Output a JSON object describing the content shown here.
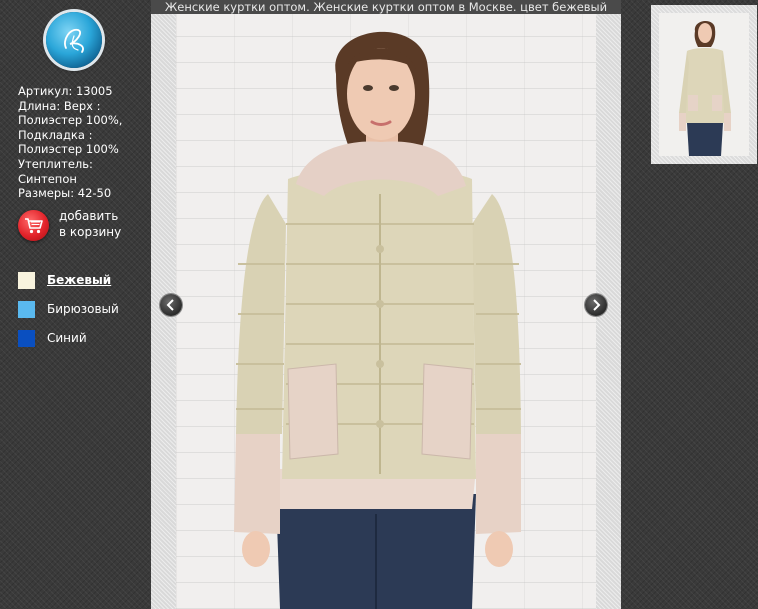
{
  "caption": "Женские куртки оптом. Женские куртки оптом в Москве. цвет бежевый",
  "product": {
    "lines": [
      "Артикул: 13005",
      "Длина: Верх :",
      "Полиэстер 100%,",
      "Подкладка :",
      "Полиэстер 100%",
      "Утеплитель:",
      "Синтепон",
      "Размеры: 42-50"
    ]
  },
  "cart": {
    "line1": "добавить",
    "line2": "в корзину",
    "icon": "cart-icon"
  },
  "colors": [
    {
      "label": "Бежевый",
      "hex": "#f8f3de",
      "active": true
    },
    {
      "label": "Бирюзовый",
      "hex": "#5ab9ef",
      "active": false
    },
    {
      "label": "Синий",
      "hex": "#0a4fc0",
      "active": false
    }
  ],
  "nav": {
    "prev_icon": "chevron-left-icon",
    "next_icon": "chevron-right-icon"
  },
  "theme": {
    "background": "#3a3a3a",
    "accent_red": "#e2232a",
    "logo_blue": "#2aa6d9"
  }
}
